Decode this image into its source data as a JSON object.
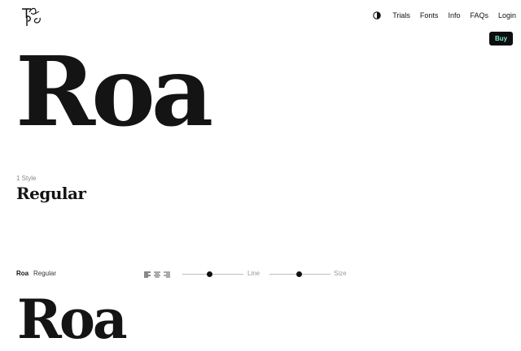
{
  "header": {
    "logo_icon": "type-foundry-logo-icon",
    "nav": {
      "theme_toggle_icon": "contrast-icon",
      "items": [
        "Trials",
        "Fonts",
        "Info",
        "FAQs",
        "Login"
      ]
    },
    "buy_label": "Buy",
    "buy_text_color": "#7fe8cf"
  },
  "hero": {
    "title": "Roa"
  },
  "styles": {
    "count_label": "1 Style",
    "name": "Regular"
  },
  "tester": {
    "family": "Roa",
    "style": "Regular",
    "align_icons": [
      "align-left-icon",
      "align-center-icon",
      "align-right-icon"
    ],
    "line_label": "Line",
    "line_value": 0.45,
    "size_label": "Size",
    "size_value": 0.48,
    "preview_text": "Roa"
  }
}
